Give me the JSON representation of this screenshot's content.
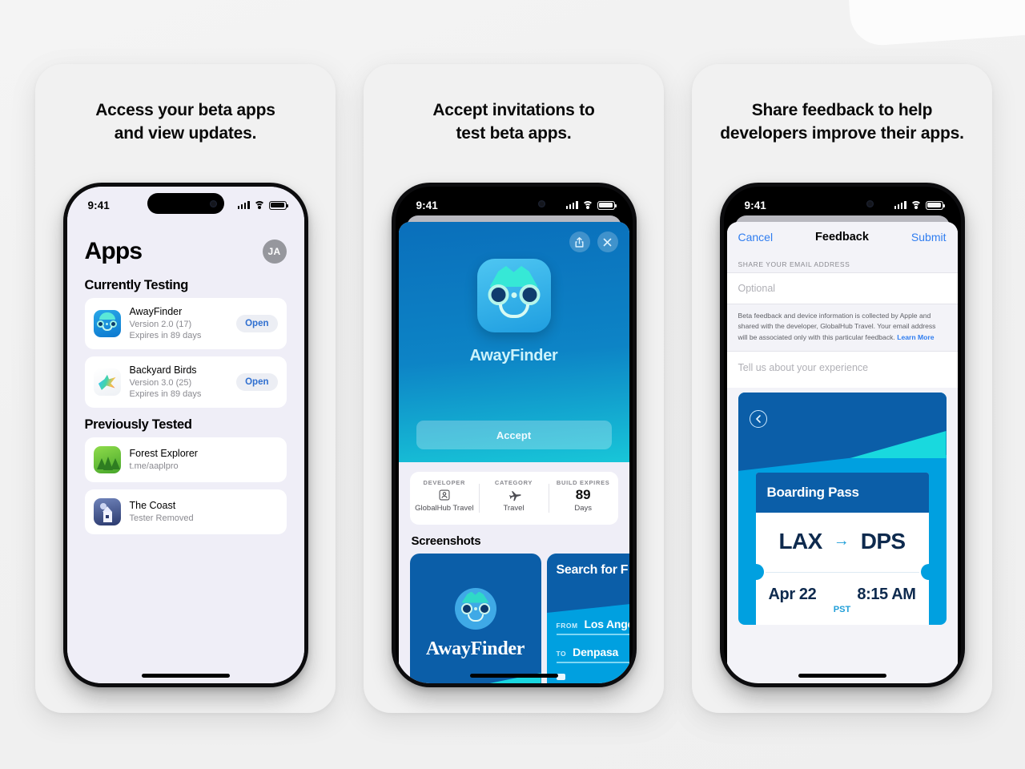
{
  "cards": [
    {
      "headline": "Access your beta apps\nand view updates."
    },
    {
      "headline": "Accept invitations to\ntest beta apps."
    },
    {
      "headline": "Share feedback to help\ndevelopers improve their apps."
    }
  ],
  "status_bar": {
    "time": "9:41",
    "signal_icon": "cellular-bars-icon",
    "wifi_icon": "wifi-icon",
    "battery_icon": "battery-icon"
  },
  "phone1": {
    "title": "Apps",
    "avatar_initials": "JA",
    "sections": [
      {
        "title": "Currently Testing",
        "rows": [
          {
            "icon": "awayfinder-app-icon",
            "name": "AwayFinder",
            "version": "Version 2.0 (17)",
            "expiry": "Expires in 89 days",
            "action": "Open"
          },
          {
            "icon": "backyard-birds-app-icon",
            "name": "Backyard Birds",
            "version": "Version 3.0 (25)",
            "expiry": "Expires in 89 days",
            "action": "Open"
          }
        ]
      },
      {
        "title": "Previously Tested",
        "rows": [
          {
            "icon": "forest-explorer-app-icon",
            "name": "Forest Explorer",
            "version": "t.me/aaplpro",
            "expiry": "",
            "action": ""
          },
          {
            "icon": "the-coast-app-icon",
            "name": "The Coast",
            "version": "Tester Removed",
            "expiry": "",
            "action": ""
          }
        ]
      }
    ]
  },
  "phone2": {
    "share_icon": "share-icon",
    "close_icon": "close-icon",
    "app_name": "AwayFinder",
    "accept_label": "Accept",
    "meta": [
      {
        "label": "DEVELOPER",
        "icon": "person-badge-icon",
        "value": "GlobalHub Travel"
      },
      {
        "label": "CATEGORY",
        "icon": "airplane-icon",
        "value": "Travel"
      },
      {
        "label": "BUILD EXPIRES",
        "big": "89",
        "value": "Days"
      }
    ],
    "screenshots_heading": "Screenshots",
    "screenshot_1": {
      "wordmark": "AwayFinder"
    },
    "screenshot_2": {
      "title": "Search for F",
      "from_label": "FROM",
      "from_value": "Los Ange",
      "to_label": "TO",
      "to_value": "Denpasa"
    }
  },
  "phone3": {
    "cancel_label": "Cancel",
    "title": "Feedback",
    "submit_label": "Submit",
    "email_group_header": "SHARE YOUR EMAIL ADDRESS",
    "email_placeholder": "Optional",
    "disclaimer": "Beta feedback and device information is collected by Apple and shared with the developer, GlobalHub Travel. Your email address will be associated only with this particular feedback.",
    "learn_more": "Learn More",
    "experience_placeholder": "Tell us about your experience",
    "screenshot": {
      "back_icon": "chevron-left-circle-icon",
      "pass_title": "Boarding Pass",
      "origin": "LAX",
      "arrow_icon": "arrow-right-icon",
      "destination": "DPS",
      "date": "Apr 22",
      "time": "8:15 AM",
      "timezone": "PST"
    }
  },
  "colors": {
    "background": "#f2f2f2",
    "card": "#f1f1f1",
    "accent_blue": "#2f7df0",
    "brand_blue": "#0b5ea8",
    "cyan": "#18c6d8",
    "avatar_gray": "#96979d"
  }
}
